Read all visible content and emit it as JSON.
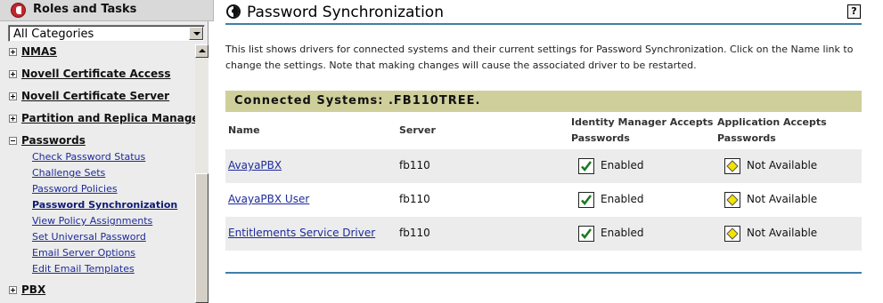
{
  "left_panel": {
    "title": "Roles and Tasks",
    "category_select": {
      "value": "All Categories"
    },
    "categories": [
      {
        "label": "NMAS",
        "expanded": false
      },
      {
        "label": "Novell Certificate Access",
        "expanded": false
      },
      {
        "label": "Novell Certificate Server",
        "expanded": false
      },
      {
        "label": "Partition and Replica Management",
        "expanded": false
      },
      {
        "label": "Passwords",
        "expanded": true
      },
      {
        "label": "PBX",
        "expanded": false
      }
    ],
    "password_tasks": [
      "Check Password Status",
      "Challenge Sets",
      "Password Policies",
      "Password Synchronization",
      "View Policy Assignments",
      "Set Universal Password",
      "Email Server Options",
      "Edit Email Templates"
    ],
    "active_task": "Password Synchronization"
  },
  "main": {
    "title": "Password Synchronization",
    "help_label": "?",
    "description": "This list shows drivers for connected systems and their current settings for Password Synchronization. Click on the Name link to change the settings. Note that making changes will cause the associated driver to be restarted.",
    "connected_systems": "Connected Systems: .FB110TREE.",
    "columns": {
      "name": "Name",
      "server": "Server",
      "idm_line1": "Identity Manager Accepts",
      "idm_line2": "Passwords",
      "app_line1": "Application Accepts",
      "app_line2": "Passwords"
    },
    "rows": [
      {
        "name": "AvayaPBX",
        "server": "fb110",
        "idm": "Enabled",
        "app": "Not Available"
      },
      {
        "name": "AvayaPBX User",
        "server": "fb110",
        "idm": "Enabled",
        "app": "Not Available"
      },
      {
        "name": "Entitlements Service Driver",
        "server": "fb110",
        "idm": "Enabled",
        "app": "Not Available"
      }
    ]
  },
  "icons": {
    "roles_tasks": "roles-tasks-icon",
    "page": "password-sync-icon",
    "enabled": "checkmark-icon",
    "not_available": "diamond-icon"
  },
  "colors": {
    "accent_rule": "#3f7fa6",
    "connected_bar": "#cfcf9b",
    "link": "#1c2b9a",
    "check_green": "#1f7a1f",
    "diamond_yellow": "#f4e400"
  }
}
